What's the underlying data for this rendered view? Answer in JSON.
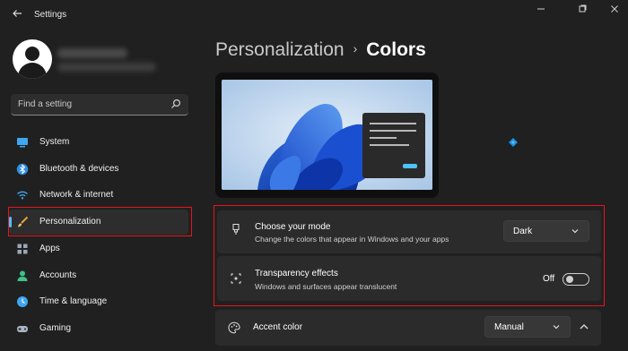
{
  "window": {
    "title": "Settings",
    "back_icon": "back-arrow-icon",
    "controls": [
      "minimize-icon",
      "maximize-icon",
      "close-icon"
    ]
  },
  "sidebar": {
    "search": {
      "placeholder": "Find a setting",
      "icon": "search-icon"
    },
    "items": [
      {
        "label": "System",
        "icon": "monitor-icon",
        "active": false
      },
      {
        "label": "Bluetooth & devices",
        "icon": "bluetooth-icon",
        "active": false
      },
      {
        "label": "Network & internet",
        "icon": "wifi-icon",
        "active": false
      },
      {
        "label": "Personalization",
        "icon": "brush-icon",
        "active": true
      },
      {
        "label": "Apps",
        "icon": "apps-icon",
        "active": false
      },
      {
        "label": "Accounts",
        "icon": "person-icon",
        "active": false
      },
      {
        "label": "Time & language",
        "icon": "globe-clock-icon",
        "active": false
      },
      {
        "label": "Gaming",
        "icon": "gamepad-icon",
        "active": false
      }
    ]
  },
  "main": {
    "breadcrumb": {
      "parent": "Personalization",
      "separator": "›",
      "current": "Colors"
    },
    "settings": {
      "mode": {
        "title": "Choose your mode",
        "subtitle": "Change the colors that appear in Windows and your apps",
        "value": "Dark",
        "icon": "paint-brush-icon"
      },
      "transparency": {
        "title": "Transparency effects",
        "subtitle": "Windows and surfaces appear translucent",
        "state": "Off",
        "icon": "sparkle-icon"
      },
      "accent": {
        "title": "Accent color",
        "value": "Manual",
        "icon": "palette-icon"
      }
    }
  },
  "colors": {
    "accent": "#4cc2ff",
    "highlight": "#e8141d",
    "background": "#202020",
    "card": "#2b2b2b"
  }
}
